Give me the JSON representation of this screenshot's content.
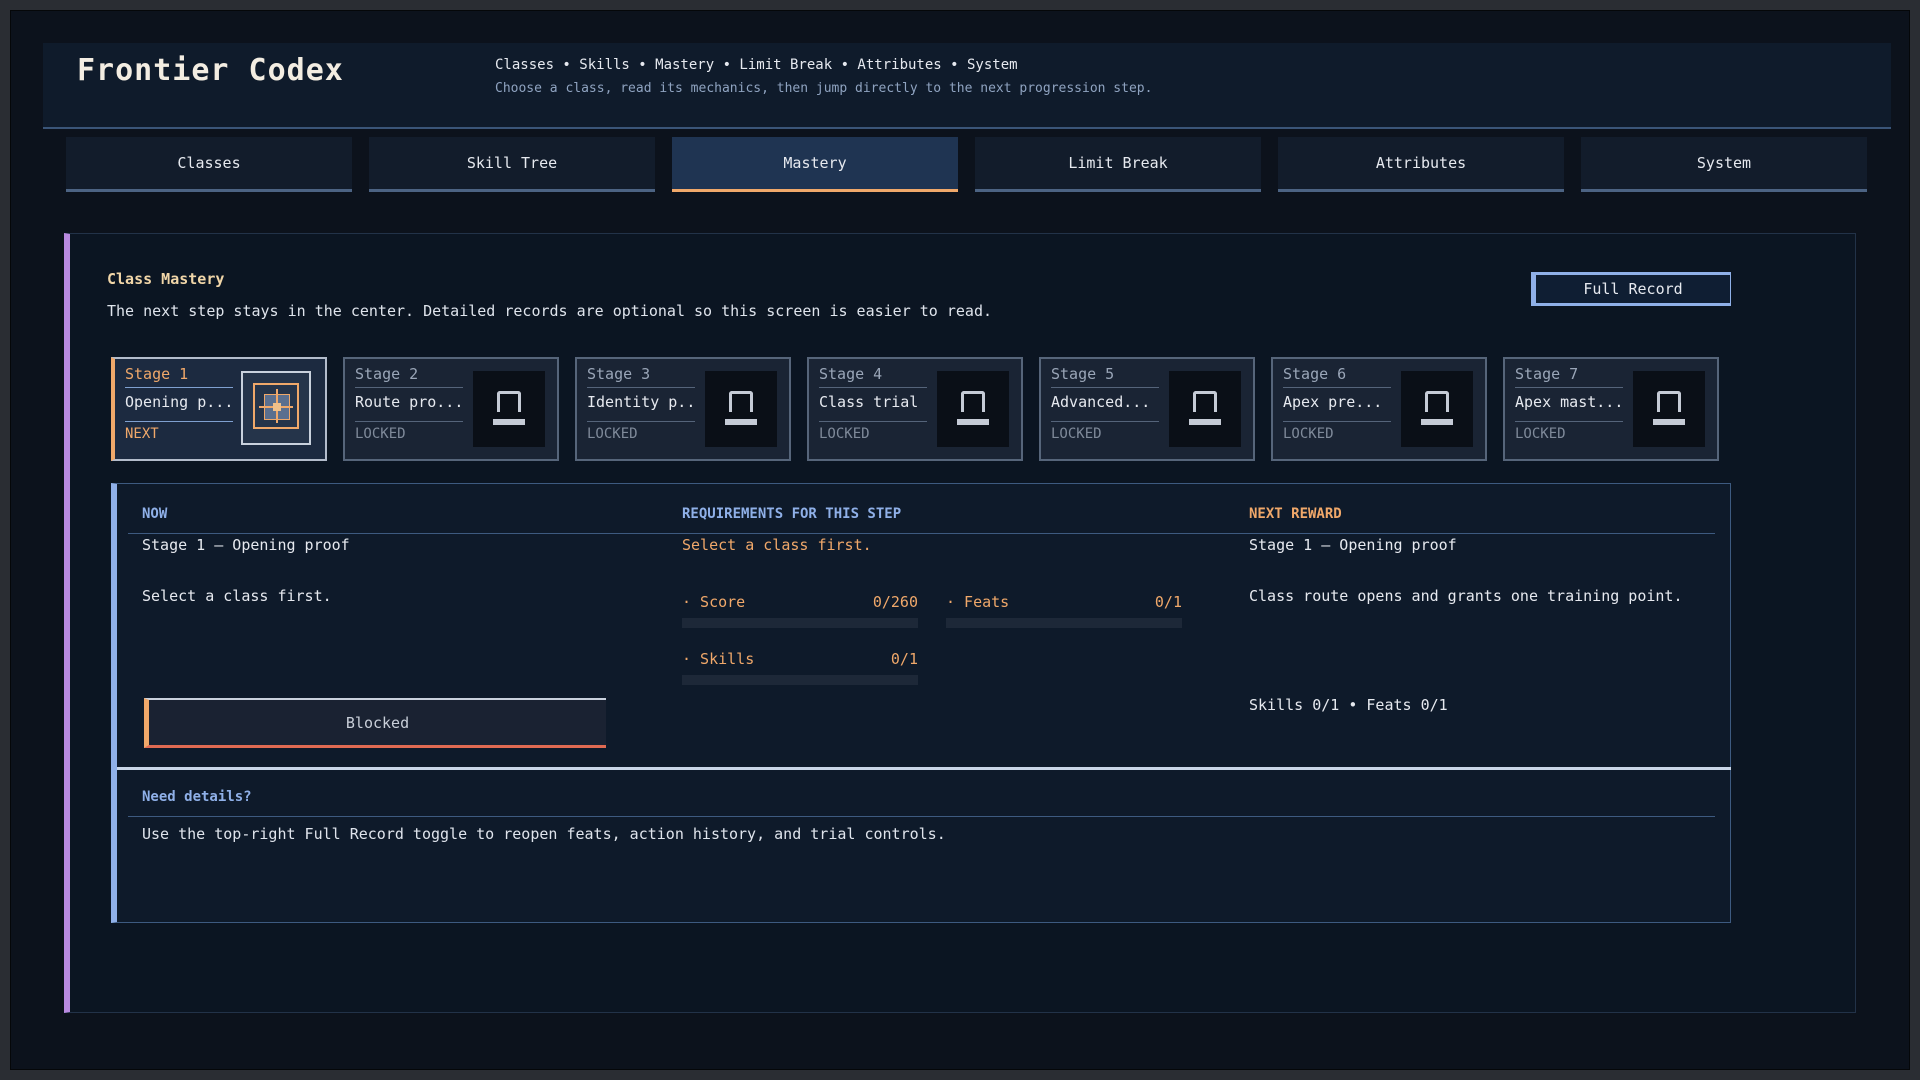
{
  "header": {
    "title": "Frontier Codex",
    "breadcrumb": "Classes • Skills • Mastery • Limit Break • Attributes • System",
    "subtitle": "Choose a class, read its mechanics, then jump directly to the next progression step."
  },
  "tabs": [
    {
      "label": "Classes",
      "active": false
    },
    {
      "label": "Skill Tree",
      "active": false
    },
    {
      "label": "Mastery",
      "active": true
    },
    {
      "label": "Limit Break",
      "active": false
    },
    {
      "label": "Attributes",
      "active": false
    },
    {
      "label": "System",
      "active": false
    }
  ],
  "mastery": {
    "title": "Class Mastery",
    "description": "The next step stays in the center. Detailed records are optional so this screen is easier to read.",
    "full_record_label": "Full Record"
  },
  "stages": [
    {
      "label": "Stage 1",
      "name": "Opening p...",
      "status": "NEXT",
      "icon": "target-icon"
    },
    {
      "label": "Stage 2",
      "name": "Route pro...",
      "status": "LOCKED",
      "icon": "lock-icon"
    },
    {
      "label": "Stage 3",
      "name": "Identity p...",
      "status": "LOCKED",
      "icon": "lock-icon"
    },
    {
      "label": "Stage 4",
      "name": "Class trial",
      "status": "LOCKED",
      "icon": "lock-icon"
    },
    {
      "label": "Stage 5",
      "name": "Advanced...",
      "status": "LOCKED",
      "icon": "lock-icon"
    },
    {
      "label": "Stage 6",
      "name": "Apex pre...",
      "status": "LOCKED",
      "icon": "lock-icon"
    },
    {
      "label": "Stage 7",
      "name": "Apex mast...",
      "status": "LOCKED",
      "icon": "lock-icon"
    }
  ],
  "detail": {
    "now": {
      "heading": "NOW",
      "stage": "Stage 1 — Opening proof",
      "text": "Select a class first.",
      "button_label": "Blocked"
    },
    "requirements": {
      "heading": "REQUIREMENTS FOR THIS STEP",
      "text": "Select a class first.",
      "meters": [
        {
          "label": "· Score",
          "value": "0/260",
          "progress": 0
        },
        {
          "label": "· Feats",
          "value": "0/1",
          "progress": 0
        },
        {
          "label": "· Skills",
          "value": "0/1",
          "progress": 0
        }
      ]
    },
    "reward": {
      "heading": "NEXT REWARD",
      "stage": "Stage 1 — Opening proof",
      "text": "Class route opens and grants one training point.",
      "counts": "Skills 0/1 • Feats 0/1"
    },
    "help": {
      "title": "Need details?",
      "text": "Use the top-right Full Record toggle to reopen feats, action history, and trial controls."
    }
  },
  "colors": {
    "accent": "#f0a86a",
    "info": "#8fb0e8",
    "panel_edge": "#b98ae0",
    "blocked": "#e06a52"
  }
}
